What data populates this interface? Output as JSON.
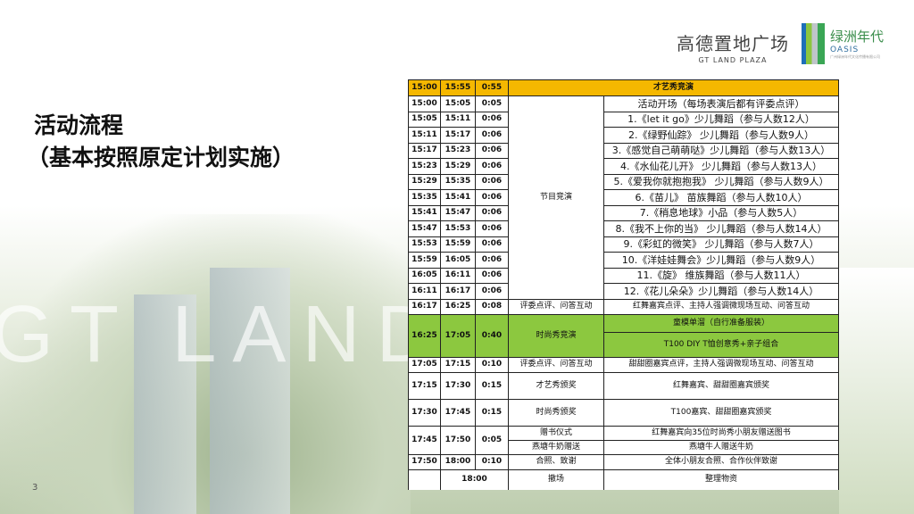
{
  "title": {
    "line1": "活动流程",
    "line2": "（基本按照原定计划实施）"
  },
  "page_number": "3",
  "watermark": "GT LAND PLAZA",
  "logos": {
    "gt": {
      "cn": "高德置地广场",
      "en": "GT LAND PLAZA"
    },
    "oasis": {
      "cn": "绿洲年代",
      "en": "OASIS",
      "small": "广州绿洲年代文化传播有限公司"
    }
  },
  "colors": {
    "header": "#f5b800",
    "green": "#8cc83f"
  },
  "header": {
    "start": "15:00",
    "end": "15:55",
    "dur": "0:55",
    "name": "才艺秀竞演"
  },
  "segment1": "节目竞演",
  "program": [
    {
      "start": "15:00",
      "end": "15:05",
      "dur": "0:05",
      "desc": "活动开场（每场表演后都有评委点评）"
    },
    {
      "start": "15:05",
      "end": "15:11",
      "dur": "0:06",
      "desc": "1.《let it go》少儿舞蹈（参与人数12人）"
    },
    {
      "start": "15:11",
      "end": "15:17",
      "dur": "0:06",
      "desc": "2.《绿野仙踪》 少儿舞蹈（参与人数9人）"
    },
    {
      "start": "15:17",
      "end": "15:23",
      "dur": "0:06",
      "desc": "3.《感觉自己萌萌哒》少儿舞蹈（参与人数13人）"
    },
    {
      "start": "15:23",
      "end": "15:29",
      "dur": "0:06",
      "desc": "4.《水仙花儿开》 少儿舞蹈（参与人数13人）"
    },
    {
      "start": "15:29",
      "end": "15:35",
      "dur": "0:06",
      "desc": "5.《爱我你就抱抱我》 少儿舞蹈（参与人数9人）"
    },
    {
      "start": "15:35",
      "end": "15:41",
      "dur": "0:06",
      "desc": "6.《苗儿》 苗族舞蹈（参与人数10人）"
    },
    {
      "start": "15:41",
      "end": "15:47",
      "dur": "0:06",
      "desc": "7.《稍息地球》小品（参与人数5人）"
    },
    {
      "start": "15:47",
      "end": "15:53",
      "dur": "0:06",
      "desc": "8.《我不上你的当》 少儿舞蹈（参与人数14人）"
    },
    {
      "start": "15:53",
      "end": "15:59",
      "dur": "0:06",
      "desc": "9.《彩虹的微笑》 少儿舞蹈（参与人数7人）"
    },
    {
      "start": "15:59",
      "end": "16:05",
      "dur": "0:06",
      "desc": "10.《洋娃娃舞会》少儿舞蹈（参与人数9人）"
    },
    {
      "start": "16:05",
      "end": "16:11",
      "dur": "0:06",
      "desc": "11.《旋》 维族舞蹈（参与人数11人）"
    },
    {
      "start": "16:11",
      "end": "16:17",
      "dur": "0:06",
      "desc": "12.《花儿朵朵》少儿舞蹈（参与人数14人）"
    }
  ],
  "r1617": {
    "start": "16:17",
    "end": "16:25",
    "dur": "0:08",
    "seg": "评委点评、问答互动",
    "desc": "红舞嘉宾点评、主持人强调微现场互动、问答互动"
  },
  "fashion": {
    "start": "16:25",
    "end": "17:05",
    "dur": "0:40",
    "seg": "时尚秀竞演",
    "desc1": "童模单溜（自行准备服装）",
    "desc2": "T100 DIY T恤创意秀+亲子组合"
  },
  "r1705": {
    "start": "17:05",
    "end": "17:15",
    "dur": "0:10",
    "seg": "评委点评、问答互动",
    "desc": "甜甜圈嘉宾点评，主持人强调微现场互动、问答互动"
  },
  "r1715": {
    "start": "17:15",
    "end": "17:30",
    "dur": "0:15",
    "seg": "才艺秀颁奖",
    "desc": "红舞嘉宾、甜甜圈嘉宾颁奖"
  },
  "r1730": {
    "start": "17:30",
    "end": "17:45",
    "dur": "0:15",
    "seg": "时尚秀颁奖",
    "desc": "T100嘉宾、甜甜圈嘉宾颁奖"
  },
  "r1745": {
    "start": "17:45",
    "end": "17:50",
    "dur": "0:05",
    "seg1": "赠书仪式",
    "desc1": "红舞嘉宾向35位时尚秀小朋友赠送图书",
    "seg2": "燕塘牛奶赠送",
    "desc2": "燕塘牛人赠送牛奶"
  },
  "r1750": {
    "start": "17:50",
    "end": "18:00",
    "dur": "0:10",
    "seg": "合照、致谢",
    "desc": "全体小朋友合照、合作伙伴致谢"
  },
  "r1800": {
    "end": "18:00",
    "seg": "撤场",
    "desc": "整理物资"
  }
}
